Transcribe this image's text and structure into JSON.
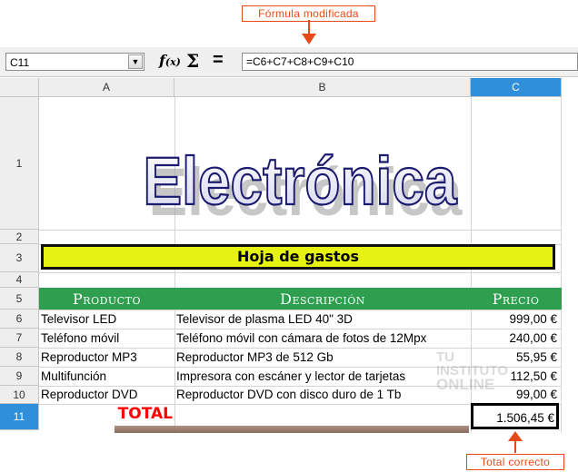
{
  "annotations": {
    "top": "Fórmula modificada",
    "bottom": "Total correcto"
  },
  "formula_bar": {
    "name_box": "C11",
    "function_wizard_icon": "fx-icon",
    "sum_icon": "sigma-icon",
    "equals_symbol": "=",
    "formula": "=C6+C7+C8+C9+C10"
  },
  "columns": [
    "A",
    "B",
    "C"
  ],
  "rows": [
    "1",
    "2",
    "3",
    "4",
    "5",
    "6",
    "7",
    "8",
    "9",
    "10",
    "11"
  ],
  "sheet": {
    "title_art": "Electrónica",
    "banner": "Hoja de gastos",
    "headers": {
      "producto": "Producto",
      "descripcion": "Descripción",
      "precio": "Precio"
    },
    "items": [
      {
        "producto": "Televisor LED",
        "descripcion": "Televisor de plasma LED 40\" 3D",
        "precio": "999,00 €"
      },
      {
        "producto": "Teléfono móvil",
        "descripcion": "Teléfono móvil con cámara de fotos de 12Mpx",
        "precio": "240,00 €"
      },
      {
        "producto": "Reproductor MP3",
        "descripcion": "Reproductor MP3 de 512 Gb",
        "precio": "55,95 €"
      },
      {
        "producto": "Multifunción",
        "descripcion": "Impresora con escáner y lector de tarjetas",
        "precio": "112,50 €"
      },
      {
        "producto": "Reproductor DVD",
        "descripcion": "Reproductor DVD con disco duro de 1 Tb",
        "precio": "99,00 €"
      }
    ],
    "total_label": "TOTAL",
    "total_value": "1.506,45 €"
  },
  "watermark": [
    "TU",
    "INSTITUTO",
    "ONLINE"
  ],
  "colors": {
    "accent_orange": "#e64a19",
    "header_green": "#2e9e4f",
    "banner_yellow": "#e6f212",
    "selected_blue": "#2f8fdb",
    "total_red": "#ff0000"
  }
}
